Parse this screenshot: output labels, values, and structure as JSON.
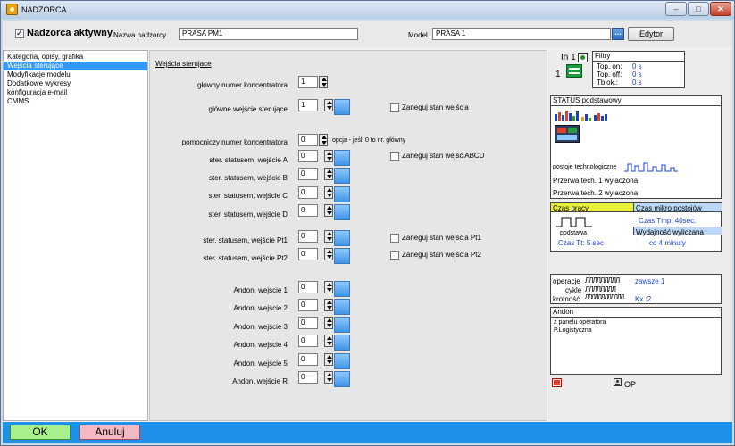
{
  "window": {
    "title": "NADZORCA",
    "min": "–",
    "max": "□",
    "close": "✕"
  },
  "top": {
    "active_label": "Nadzorca aktywny",
    "name_label": "Nazwa nadzorcy",
    "name_value": "PRASA PM1",
    "model_label": "Model",
    "model_value": "PRASA 1",
    "browse": "...",
    "editor": "Edytor"
  },
  "sidebar": {
    "items": [
      {
        "label": "Kategoria, opisy, grafika"
      },
      {
        "label": "Wejścia sterujące"
      },
      {
        "label": "Modyfikacje modelu"
      },
      {
        "label": "Dodatkowe wykresy"
      },
      {
        "label": "konfiguracja e-mail"
      },
      {
        "label": "CMMS"
      }
    ]
  },
  "main": {
    "section_title": "Wejścia sterujace",
    "fields": [
      {
        "label": "główny numer koncentratora",
        "value": "1"
      },
      {
        "label": "główne wejście sterujące",
        "value": "1"
      },
      {
        "label": "pomocniczy numer koncentratora",
        "value": "0"
      },
      {
        "label": "ster. statusem, wejście A",
        "value": "0"
      },
      {
        "label": "ster. statusem, wejście B",
        "value": "0"
      },
      {
        "label": "ster. statusem, wejście C",
        "value": "0"
      },
      {
        "label": "ster. statusem, wejście D",
        "value": "0"
      },
      {
        "label": "ster. statusem, wejście Pt1",
        "value": "0"
      },
      {
        "label": "ster. statusem, wejście Pt2",
        "value": "0"
      },
      {
        "label": "Andon, wejście 1",
        "value": "0"
      },
      {
        "label": "Andon, wejście 2",
        "value": "0"
      },
      {
        "label": "Andon, wejście 3",
        "value": "0"
      },
      {
        "label": "Andon, wejście 4",
        "value": "0"
      },
      {
        "label": "Andon, wejście 5",
        "value": "0"
      },
      {
        "label": "Andon, wejście R",
        "value": "0"
      }
    ],
    "aux_note": "opcja - jeśli 0 to nr. główny",
    "neg_main": "Zaneguj stan wejścia",
    "neg_abcd": "Zaneguj stan wejść ABCD",
    "neg_pt1": "Zaneguj stan wejścia Pt1",
    "neg_pt2": "Zaneguj stan wejścia Pt2"
  },
  "right": {
    "in_label": "In 1",
    "in_count": "1",
    "filters": {
      "title": "Filtry",
      "rows": [
        {
          "k": "Top. on:",
          "v": "0 s"
        },
        {
          "k": "Top. off:",
          "v": "0 s"
        },
        {
          "k": "Tblok.:",
          "v": "0 s"
        }
      ]
    },
    "status": {
      "title": "STATUS podstawowy",
      "tech_label": "postoje technologiczne",
      "break1": "Przerwa tech. 1 wyłaczona",
      "break2": "Przerwa tech. 2 wyłaczona"
    },
    "work": {
      "title": "Czas pracy",
      "base": "podstawa",
      "tt": "Czas Tt: 5 sec",
      "micro_title": "Czas mikro postojów",
      "tmp": "Czas Tmp: 40sec.",
      "eff_title": "Wydajność wyliczana",
      "eff": "co 4 minuty"
    },
    "ops": {
      "op_label": "operacje",
      "op_pulse": "ЛЛЛЛЛЛЛЛЛ",
      "op_value": "zawsze 1",
      "cyc_label": "cykle",
      "cyc_pulse": "ЛЛЛЛЛЛЛЛ",
      "mult_label": "krotność",
      "mult_pulse": "ЛЛЛЛЛЛЛЛЛЛЛЛ",
      "mult_value": "Kx :2"
    },
    "andon": {
      "title": "Andon",
      "line1": "z panelu operatora",
      "line2": "P.Logistyczna"
    },
    "op_label": "OP"
  },
  "footer": {
    "ok": "OK",
    "cancel": "Anuluj"
  },
  "colors": {
    "accent": "#1e90e8",
    "ok_bg": "#a8f08c",
    "cancel_bg": "#f5b8c2",
    "yellow": "#e8f03a",
    "lightblue": "#bcd8f6"
  }
}
